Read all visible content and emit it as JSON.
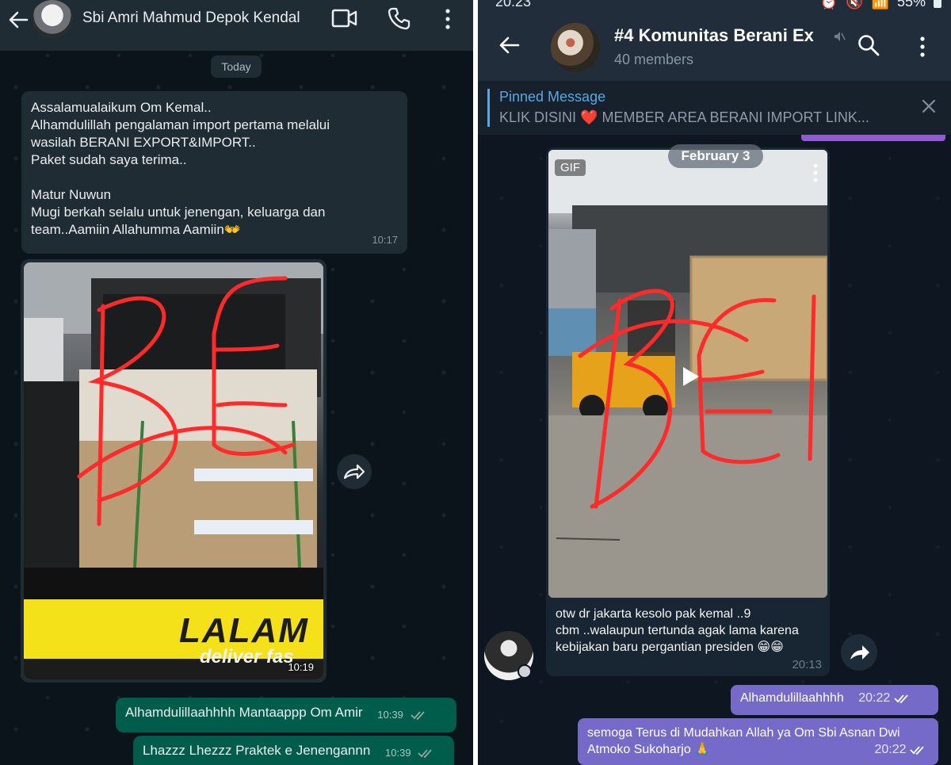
{
  "whatsapp": {
    "contact_name": "Sbi Amri Mahmud Depok Kendal",
    "date_separator": "Today",
    "incoming_message": {
      "lines": [
        "Assalamualaikum Om Kemal..",
        "Alhamdulillah pengalaman import pertama melalui",
        "wasilah BERANI EXPORT&IMPORT..",
        "Paket sudah saya terima..",
        "",
        "Matur Nuwun",
        "Mugi berkah selalu untuk jenengan, keluarga dan",
        "team..Aamiin Allahumma Aamiin👐"
      ],
      "time": "10:17"
    },
    "photo": {
      "watermark": "BEI",
      "truck_brand": "LALAM",
      "truck_tagline": "deliver fas",
      "time": "10:19"
    },
    "outgoing_messages": [
      {
        "text": "Alhamdulillaahhhh Mantaappp Om Amir",
        "time": "10:39"
      },
      {
        "text": "Lhazzz Lhezzz Praktek e Jenengannn",
        "time": "10:39"
      }
    ]
  },
  "telegram": {
    "status_time": "20:23",
    "battery": "55%",
    "group_title": "#4 Komunitas Berani Ex",
    "members": "40 members",
    "pinned": {
      "title": "Pinned Message",
      "text": "KLIK DISINI ❤️  MEMBER AREA BERANI IMPORT LINK..."
    },
    "media_message": {
      "date_chip": "February 3",
      "gif_label": "GIF",
      "watermark": "BEI",
      "caption_lines": [
        "otw dr jakarta kesolo pak kemal ..9",
        "cbm ..walaupun tertunda agak lama karena",
        "kebijakan baru pergantian presiden 😁😁"
      ],
      "time": "20:13"
    },
    "outgoing_messages": [
      {
        "text": "Alhamdulillaahhhh",
        "time": "20:22"
      },
      {
        "text_line1": "semoga Terus di Mudahkan Allah ya Om Sbi Asnan Dwi",
        "text_line2": "Atmoko Sukoharjo 🙏",
        "time": "20:22"
      }
    ]
  },
  "colors": {
    "wa_background": "#0b141a",
    "wa_incoming": "#202c33",
    "wa_outgoing": "#005c4b",
    "tg_background": "#0e1621",
    "tg_outgoing": "#766ac8",
    "tg_accent": "#5aa6e6",
    "watermark_red": "#ff2a2a"
  }
}
